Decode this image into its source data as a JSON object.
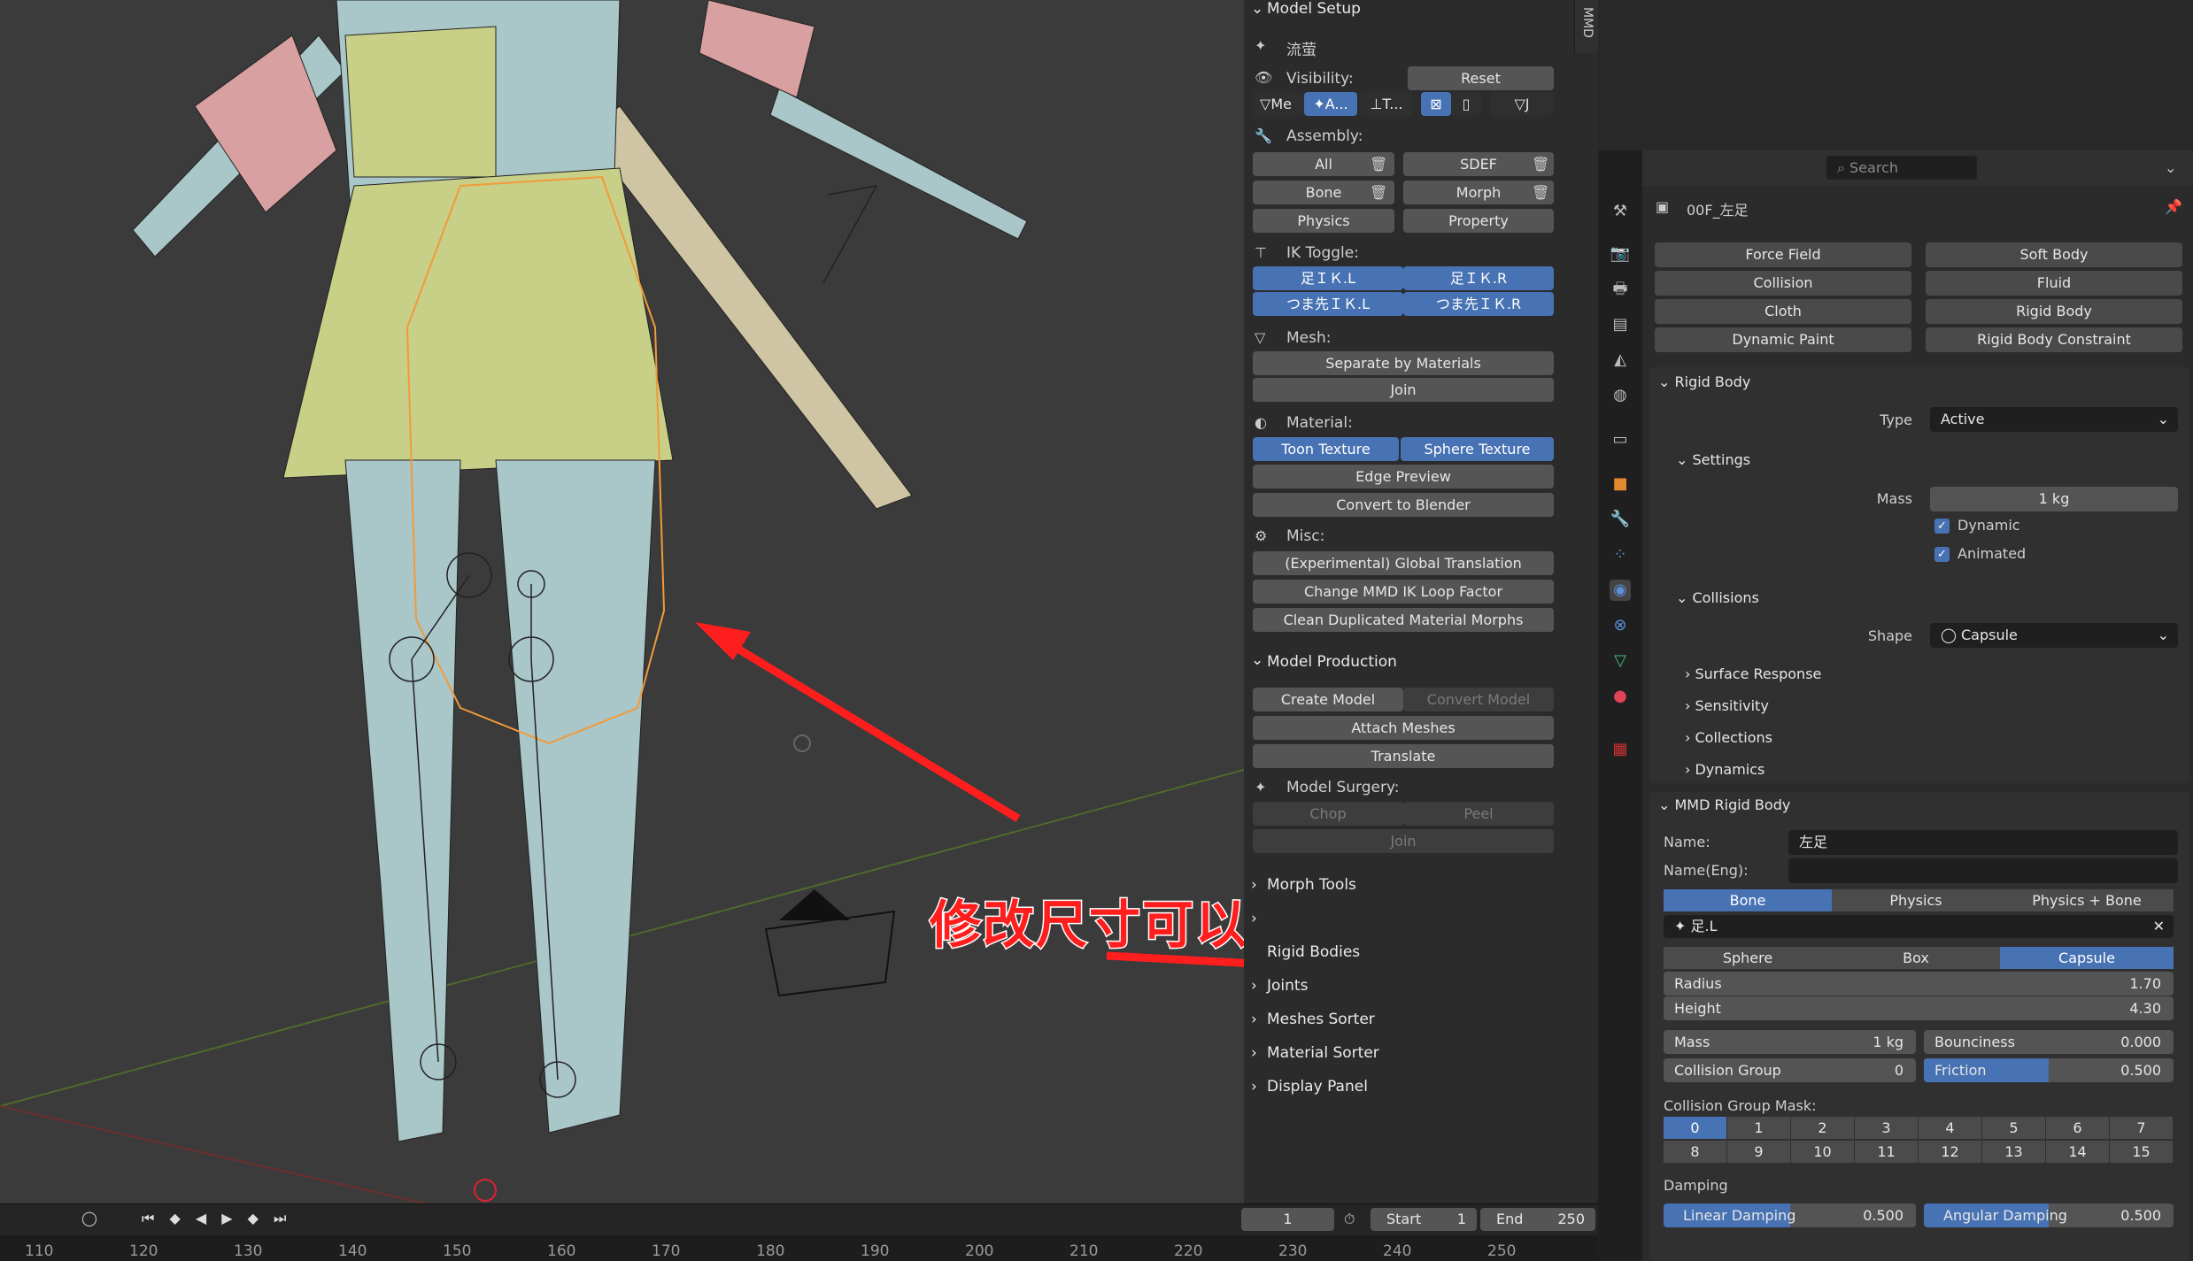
{
  "npanel": {
    "tab": "MMD",
    "model_setup": "Model Setup",
    "model_name": "流萤",
    "visibility": "Visibility:",
    "reset": "Reset",
    "vis_toggles": [
      "Me",
      "A...",
      "T...",
      "",
      "J"
    ],
    "assembly": "Assembly:",
    "asm": {
      "all": "All",
      "sdef": "SDEF",
      "bone": "Bone",
      "morph": "Morph",
      "physics": "Physics",
      "property": "Property"
    },
    "ik_toggle": "IK Toggle:",
    "ik": [
      "足ＩＫ.L",
      "足ＩＫ.R",
      "つま先ＩＫ.L",
      "つま先ＩＫ.R"
    ],
    "mesh": "Mesh:",
    "separate": "Separate by Materials",
    "join": "Join",
    "material": "Material:",
    "toon": "Toon Texture",
    "sphere": "Sphere Texture",
    "edge": "Edge Preview",
    "convert": "Convert to Blender",
    "misc": "Misc:",
    "misc_items": [
      "(Experimental) Global Translation",
      "Change MMD IK Loop Factor",
      "Clean Duplicated Material Morphs"
    ],
    "model_production": "Model Production",
    "create_model": "Create Model",
    "convert_model": "Convert Model",
    "attach_meshes": "Attach Meshes",
    "translate": "Translate",
    "model_surgery": "Model Surgery:",
    "chop": "Chop",
    "peel": "Peel",
    "surgery_join": "Join",
    "collapsed": [
      "Morph Tools",
      "Rigid Bodies",
      "Joints",
      "Meshes Sorter",
      "Material Sorter",
      "Display Panel"
    ]
  },
  "annotation": "修改尺寸可以调整碰撞",
  "timeline": {
    "frame": "1",
    "start_label": "Start",
    "start": "1",
    "end_label": "End",
    "end": "250",
    "ruler": [
      "110",
      "120",
      "130",
      "140",
      "150",
      "160",
      "170",
      "180",
      "190",
      "200",
      "210",
      "220",
      "230",
      "240",
      "250"
    ]
  },
  "props": {
    "search_placeholder": "Search",
    "object": "00F_左足",
    "physics_buttons": [
      "Force Field",
      "Soft Body",
      "Collision",
      "Fluid",
      "Cloth",
      "Rigid Body",
      "Dynamic Paint",
      "Rigid Body Constraint"
    ],
    "rigid_body": "Rigid Body",
    "type_label": "Type",
    "type_value": "Active",
    "settings": "Settings",
    "mass_label": "Mass",
    "mass_value": "1 kg",
    "dynamic": "Dynamic",
    "animated": "Animated",
    "collisions": "Collisions",
    "shape_label": "Shape",
    "shape_value": "Capsule",
    "subsections": [
      "Surface Response",
      "Sensitivity",
      "Collections",
      "Dynamics"
    ],
    "mmd_rigid_body": "MMD Rigid Body",
    "name_label": "Name:",
    "name_value": "左足",
    "name_eng_label": "Name(Eng):",
    "name_eng_value": "",
    "mode_tabs": [
      "Bone",
      "Physics",
      "Physics + Bone"
    ],
    "bone_value": "足.L",
    "shape_tabs": [
      "Sphere",
      "Box",
      "Capsule"
    ],
    "radius_label": "Radius",
    "radius_value": "1.70",
    "height_label": "Height",
    "height_value": "4.30",
    "mmd_mass_label": "Mass",
    "mmd_mass_value": "1 kg",
    "bounciness_label": "Bounciness",
    "bounciness_value": "0.000",
    "collision_group_label": "Collision Group",
    "collision_group_value": "0",
    "friction_label": "Friction",
    "friction_value": "0.500",
    "friction_fraction": 0.5,
    "mask_label": "Collision Group Mask:",
    "mask": [
      "0",
      "1",
      "2",
      "3",
      "4",
      "5",
      "6",
      "7",
      "8",
      "9",
      "10",
      "11",
      "12",
      "13",
      "14",
      "15"
    ],
    "damping_label": "Damping",
    "linear_label": "Linear Damping",
    "linear_value": "0.500",
    "angular_label": "Angular Damping",
    "angular_value": "0.500"
  },
  "colors": {
    "accent": "#4772b3",
    "annotation": "#ff1e1e",
    "mesh": "#a9c6c8",
    "skirt": "#c8cf87",
    "pink": "#d8a0a0",
    "select": "#f29a3a"
  }
}
